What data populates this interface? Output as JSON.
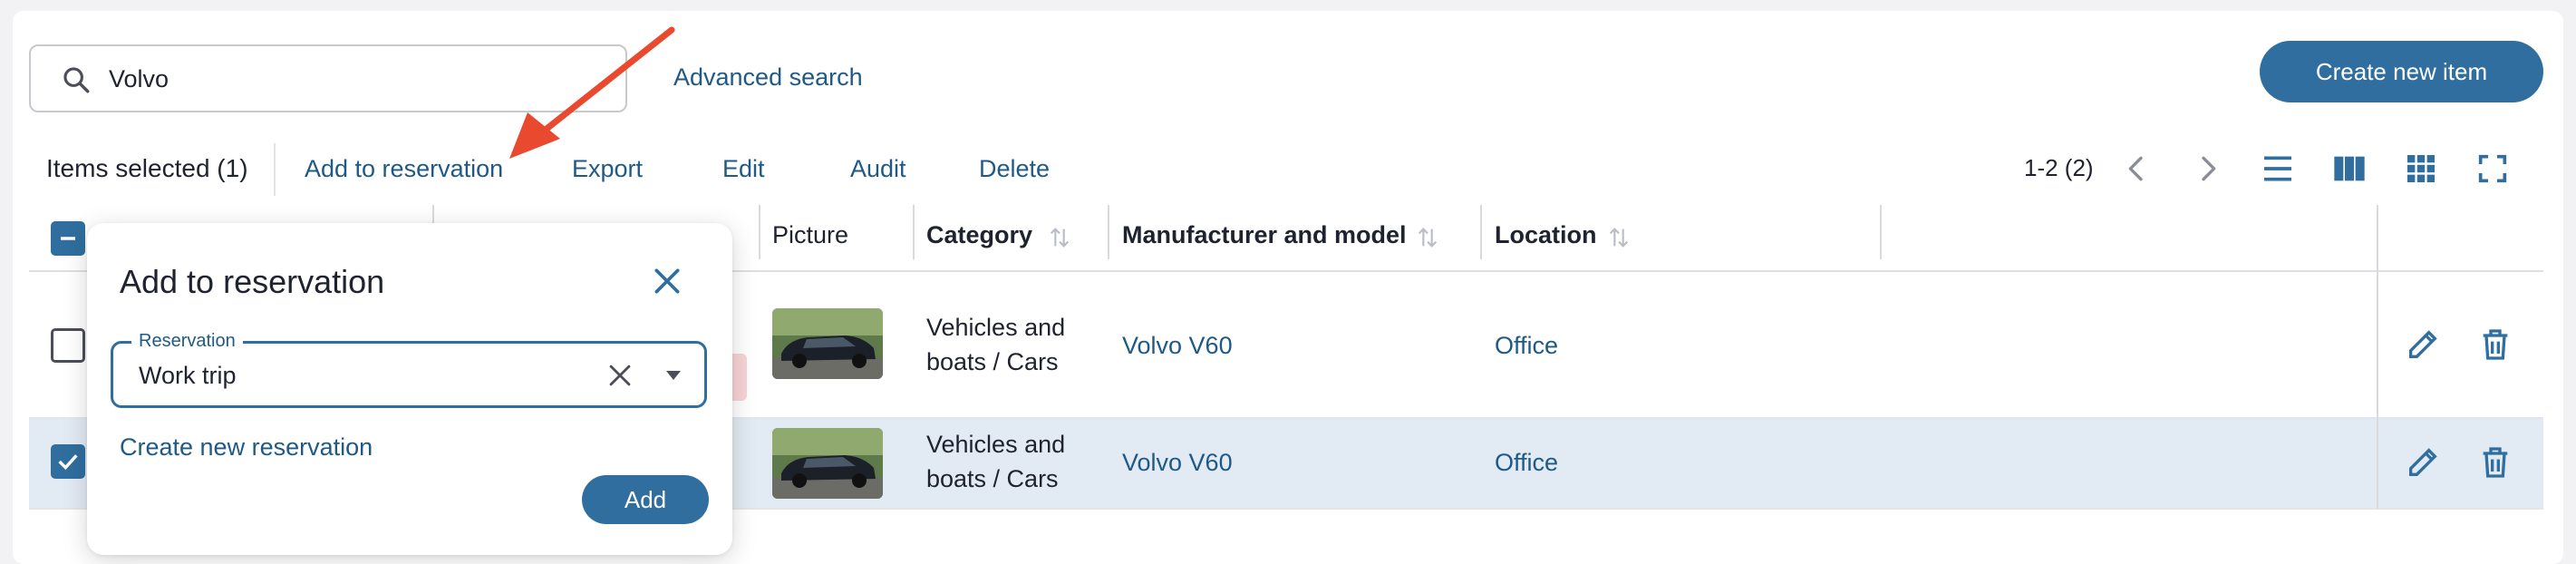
{
  "search": {
    "value": "Volvo",
    "icon": "search-icon"
  },
  "advanced_search_label": "Advanced search",
  "create_item_label": "Create new item",
  "toolbar": {
    "items_selected": "Items selected (1)",
    "actions": [
      "Add to reservation",
      "Export",
      "Edit",
      "Audit",
      "Delete"
    ],
    "pagination": "1-2 (2)"
  },
  "columns": {
    "picture": "Picture",
    "category": "Category",
    "manufacturer_model": "Manufacturer and model",
    "location": "Location"
  },
  "rows": [
    {
      "category_line1": "Vehicles and",
      "category_line2": "boats / Cars",
      "model": "Volvo V60",
      "location": "Office",
      "selected": false
    },
    {
      "category_line1": "Vehicles and",
      "category_line2": "boats / Cars",
      "model": "Volvo V60",
      "location": "Office",
      "selected": true
    }
  ],
  "popover": {
    "title": "Add to reservation",
    "reservation_label": "Reservation",
    "reservation_value": "Work trip",
    "create_new_label": "Create new reservation",
    "add_label": "Add"
  },
  "colors": {
    "accent": "#2f6e9e",
    "link": "#1f5a86",
    "selected_row": "#e2eaf3",
    "arrow": "#e8492f"
  }
}
